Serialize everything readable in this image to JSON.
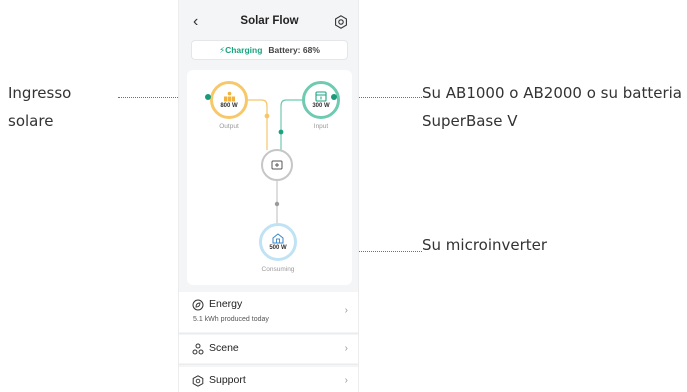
{
  "annotations": {
    "left": [
      "Ingresso",
      "solare"
    ],
    "right_top": [
      "Su AB1000 o AB2000 o su batteria",
      "SuperBase V"
    ],
    "right_bottom": "Su microinverter"
  },
  "header": {
    "back_icon": "chevron-left-icon",
    "title": "Solar Flow",
    "settings_icon": "gear-icon"
  },
  "status": {
    "charging_icon": "bolt-icon",
    "charging_label": "Charging",
    "battery_label": "Battery: 68%"
  },
  "flow": {
    "output": {
      "value": "800 W",
      "label": "Output",
      "icon": "solar-panel-icon"
    },
    "input": {
      "value": "300 W",
      "label": "Input",
      "icon": "battery-box-icon"
    },
    "center": {
      "icon": "inverter-box-icon"
    },
    "consuming": {
      "value": "500 W",
      "label": "Consuming",
      "icon": "house-icon"
    }
  },
  "menu": {
    "energy": {
      "label": "Energy",
      "subtitle": "5.1 kWh produced today",
      "icon": "leaf-circle-icon"
    },
    "scene": {
      "label": "Scene",
      "icon": "scene-nodes-icon"
    },
    "support": {
      "label": "Support",
      "icon": "support-hex-icon"
    }
  },
  "colors": {
    "accent_green": "#1aa37f",
    "solar_yellow": "#f7c86a",
    "input_green": "#6ecab0",
    "consume_blue": "#bfe3f5"
  }
}
